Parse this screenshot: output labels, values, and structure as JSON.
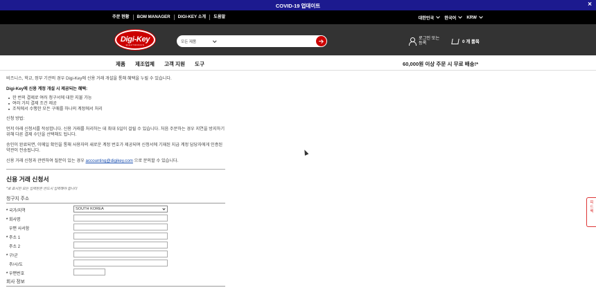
{
  "banner": {
    "title": "COVID-19 업데이트",
    "close": "×"
  },
  "topnav": {
    "links": [
      "주문 현황",
      "BOM MANAGER",
      "DIGI-KEY 소개",
      "도움말"
    ],
    "region": "대한민국",
    "language": "한국어",
    "currency": "KRW"
  },
  "header": {
    "logo_text": "Digi-Key",
    "logo_sub": "ELECTRONICS",
    "search_category": "모든 제품",
    "login_line1": "로그인 또는",
    "login_line2": "등록",
    "cart": "0 개 품목"
  },
  "mainnav": {
    "items": [
      "제품",
      "제조업체",
      "고객 지원",
      "도구"
    ],
    "promo": "60,000원 이상 주문 시 무료 배송!*"
  },
  "intro": {
    "p1": "비즈니스, 학교, 정부 기관의 경우 Digi-Key에 신용 거래 개설을 통해 혜택을 누릴 수 있습니다.",
    "benefits_title": "Digi-Key에 신용 계정 개설 시 제공되는 혜택:",
    "benefits": [
      "한 번의 결제로 여러 청구서에 대한 지불 가능",
      "여러 가지 결제 조건 제공",
      "조직에서 수행한 모든 구매를 하나의 계정에서 처리"
    ],
    "howto_title": "신청 방법:",
    "howto_p1": "먼저 아래 신청서를 작성합니다. 신용 거래를 처리하는 데 최대 5일이 걸릴 수 있습니다. 처음 주문하는 경우 지연을 방지하기 위해 다른 결제 수단을 선택해도 됩니다.",
    "howto_p2": "승인이 완료되면, 이메일 확인을 통해 사용자의 새로운 계정 번호가 제공되며 신청서에 기재된 지급 계정 담당자에게 인증된 약관이 전송됩니다.",
    "contact_pre": "신용 거래 신청과 관련하여 질문이 있는 경우 ",
    "contact_email": "accounting@digikey.com",
    "contact_post": " 으로 문의할 수 있습니다."
  },
  "form": {
    "title": "신용 거래 신청서",
    "note": "*로 표시된 모든 입력란은 반드시 입력해야 합니다",
    "billing_title": "청구지 주소",
    "fields": [
      {
        "label": "국가/지역",
        "required": "*",
        "value": "SOUTH KOREA"
      },
      {
        "label": "회사명",
        "required": "*"
      },
      {
        "label": "우편 사서함",
        "required": ""
      },
      {
        "label": "주소 1",
        "required": "*"
      },
      {
        "label": "주소 2",
        "required": ""
      },
      {
        "label": "구/군",
        "required": "*"
      },
      {
        "label": "주/시/도",
        "required": ""
      },
      {
        "label": "우편번호",
        "required": "*"
      }
    ],
    "company_title": "회사 정보"
  },
  "feedback": {
    "label": "피드백"
  }
}
